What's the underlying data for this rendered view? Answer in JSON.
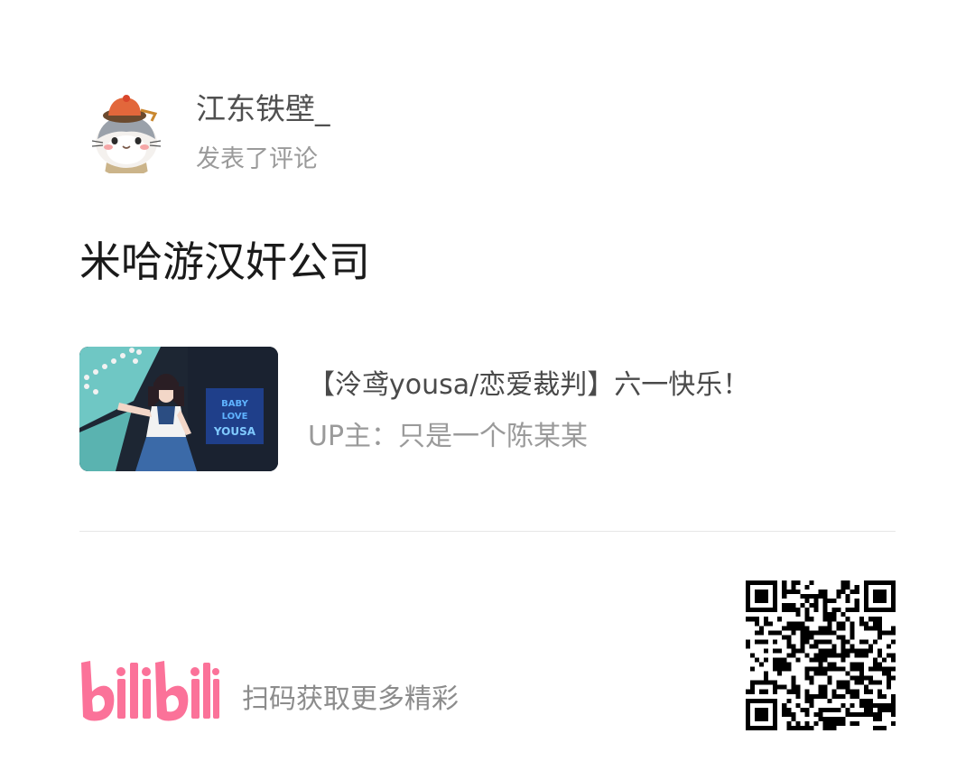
{
  "header": {
    "user_name": "江东铁壁_",
    "action_text": "发表了评论",
    "avatar_icon": "hamster-avatar-icon"
  },
  "comment": {
    "text": "米哈游汉奸公司"
  },
  "video": {
    "title": "【泠鸢yousa/恋爱裁判】六一快乐！",
    "uploader": "UP主：只是一个陈某某",
    "thumbnail_icon": "video-thumbnail-icon"
  },
  "footer": {
    "logo_text": "bilibili",
    "scan_text": "扫码获取更多精彩",
    "qr_icon": "qr-code-icon"
  },
  "colors": {
    "brand_pink": "#fb7299",
    "text_primary": "#1a1a1a",
    "text_secondary": "#9a9a9a",
    "divider": "#e6e6e6"
  }
}
